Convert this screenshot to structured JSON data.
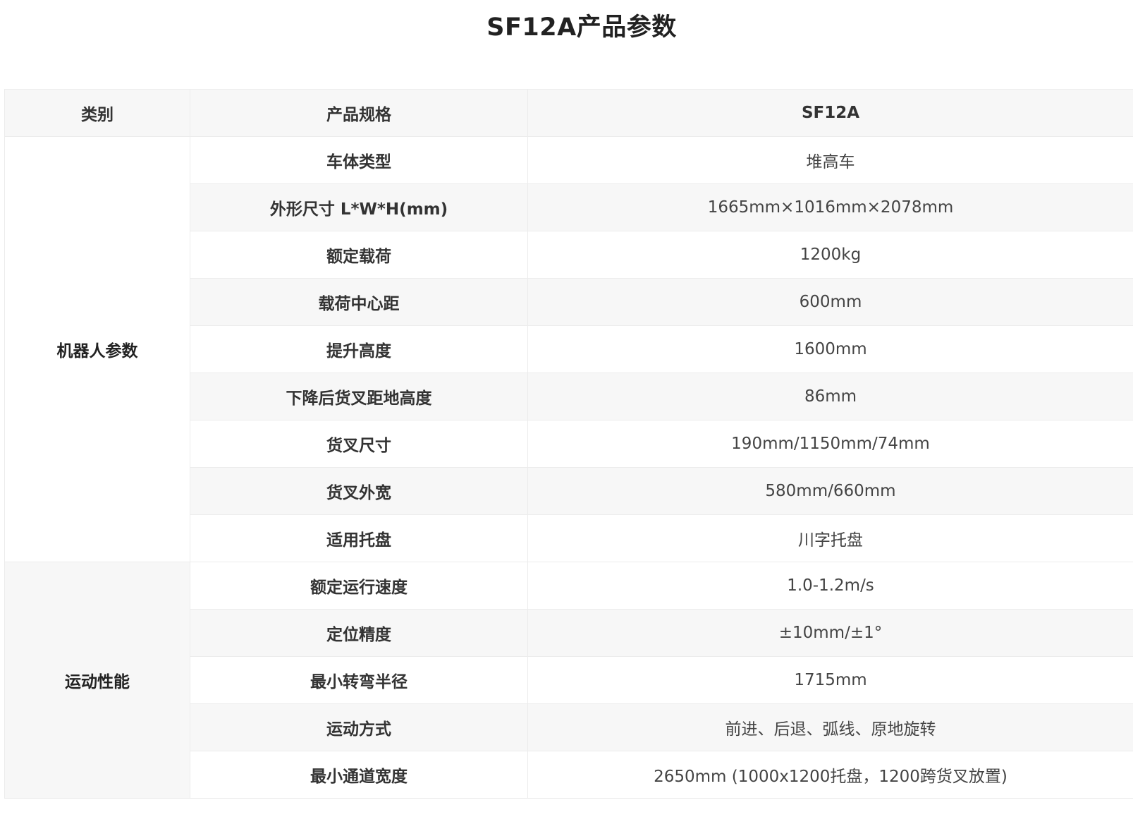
{
  "title": "SF12A产品参数",
  "header": {
    "category": "类别",
    "spec": "产品规格",
    "model": "SF12A"
  },
  "groups": [
    {
      "category": "机器人参数",
      "rows": [
        {
          "name": "车体类型",
          "value": "堆高车"
        },
        {
          "name": "外形尺寸 L*W*H(mm)",
          "value": "1665mm×1016mm×2078mm"
        },
        {
          "name": "额定载荷",
          "value": "1200kg"
        },
        {
          "name": "载荷中心距",
          "value": "600mm"
        },
        {
          "name": "提升高度",
          "value": "1600mm"
        },
        {
          "name": "下降后货叉距地高度",
          "value": "86mm"
        },
        {
          "name": "货叉尺寸",
          "value": "190mm/1150mm/74mm"
        },
        {
          "name": "货叉外宽",
          "value": "580mm/660mm"
        },
        {
          "name": "适用托盘",
          "value": "川字托盘"
        }
      ]
    },
    {
      "category": "运动性能",
      "rows": [
        {
          "name": "额定运行速度",
          "value": "1.0-1.2m/s"
        },
        {
          "name": "定位精度",
          "value": "±10mm/±1°"
        },
        {
          "name": "最小转弯半径",
          "value": "1715mm"
        },
        {
          "name": "运动方式",
          "value": "前进、后退、弧线、原地旋转"
        },
        {
          "name": "最小通道宽度",
          "value": "2650mm (1000x1200托盘，1200跨货叉放置)"
        }
      ]
    }
  ]
}
